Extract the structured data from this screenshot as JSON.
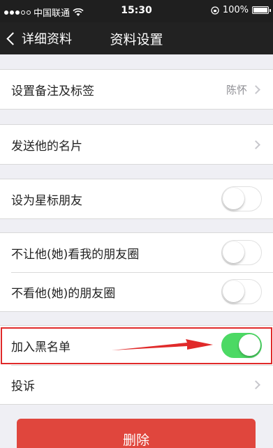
{
  "status_bar": {
    "carrier": "中国联通",
    "time": "15:30",
    "battery": "100%",
    "icons": [
      "wifi-icon",
      "lock-rotation-icon",
      "battery-icon"
    ]
  },
  "nav": {
    "back_label": "详细资料",
    "title": "资料设置"
  },
  "groups": {
    "remark": {
      "label": "设置备注及标签",
      "detail": "陈怀"
    },
    "send_card": {
      "label": "发送他的名片"
    },
    "star": {
      "label": "设为星标朋友",
      "toggle_on": false
    },
    "privacy": [
      {
        "label": "不让他(她)看我的朋友圈",
        "toggle_on": false
      },
      {
        "label": "不看他(她)的朋友圈",
        "toggle_on": false
      }
    ],
    "blacklist": {
      "label": "加入黑名单",
      "toggle_on": true
    },
    "report": {
      "label": "投诉"
    }
  },
  "actions": {
    "delete_label": "删除"
  },
  "colors": {
    "toggle_on": "#4cd964",
    "delete": "#e0463d",
    "annotation": "#e02a2a",
    "nav_bg": "#222222"
  }
}
